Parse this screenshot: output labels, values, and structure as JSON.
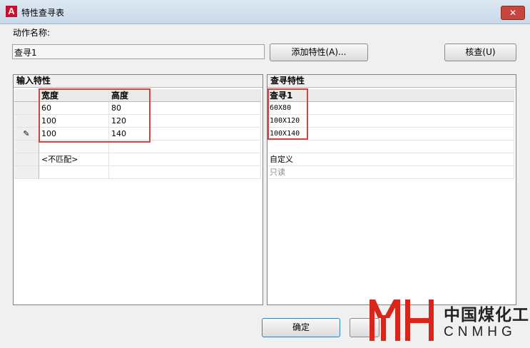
{
  "window": {
    "title": "特性查寻表",
    "close": "✕"
  },
  "action_name": {
    "label": "动作名称:",
    "value": "查寻1"
  },
  "buttons": {
    "add_property": "添加特性(A)...",
    "audit": "核查(U)",
    "ok": "确定"
  },
  "input_panel": {
    "title": "输入特性",
    "columns": [
      "宽度",
      "高度"
    ],
    "rows": [
      {
        "marker": "",
        "values": [
          "60",
          "80"
        ]
      },
      {
        "marker": "",
        "values": [
          "100",
          "120"
        ]
      },
      {
        "marker": "✎",
        "values": [
          "100",
          "140"
        ]
      },
      {
        "marker": "",
        "values": [
          "",
          ""
        ]
      },
      {
        "marker": "",
        "values": [
          "<不匹配>",
          ""
        ]
      },
      {
        "marker": "",
        "values": [
          "",
          ""
        ]
      }
    ]
  },
  "lookup_panel": {
    "title": "查寻特性",
    "column": "查寻1",
    "rows": [
      "60X80",
      "100X120",
      "100X140",
      "",
      "自定义",
      "只读"
    ]
  },
  "watermark": {
    "logo": "MYH",
    "name": "中国煤化工",
    "sub": "CNMHG"
  },
  "colors": {
    "highlight": "#d94040",
    "logo": "#d8261b",
    "readonly": "#8a8a8a"
  }
}
